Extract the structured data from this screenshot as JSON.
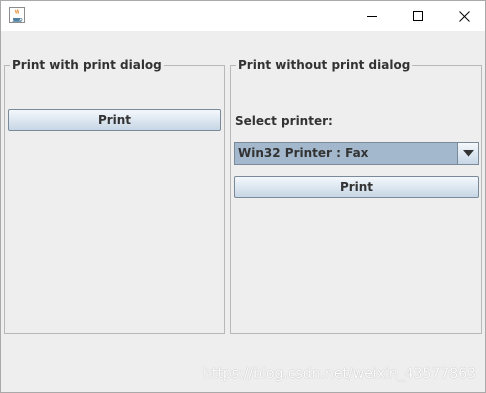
{
  "window": {
    "minimize_icon": "minimize-icon",
    "maximize_icon": "maximize-icon",
    "close_icon": "close-icon",
    "app_icon": "java-coffee-cup-icon"
  },
  "left_panel": {
    "title": "Print with print dialog",
    "print_button": "Print"
  },
  "right_panel": {
    "title": "Print without print dialog",
    "select_label": "Select printer:",
    "printer_select": {
      "value": "Win32 Printer : Fax",
      "arrow_icon": "chevron-down-icon"
    },
    "print_button": "Print"
  },
  "watermark": "https://blog.csdn.net/weixin_43577863",
  "colors": {
    "background": "#eeeeee",
    "button_gradient_top": "#f4f8fc",
    "button_gradient_bottom": "#c7d6e5",
    "combo_selected": "#a3b8cc",
    "border": "#7a8a99"
  }
}
